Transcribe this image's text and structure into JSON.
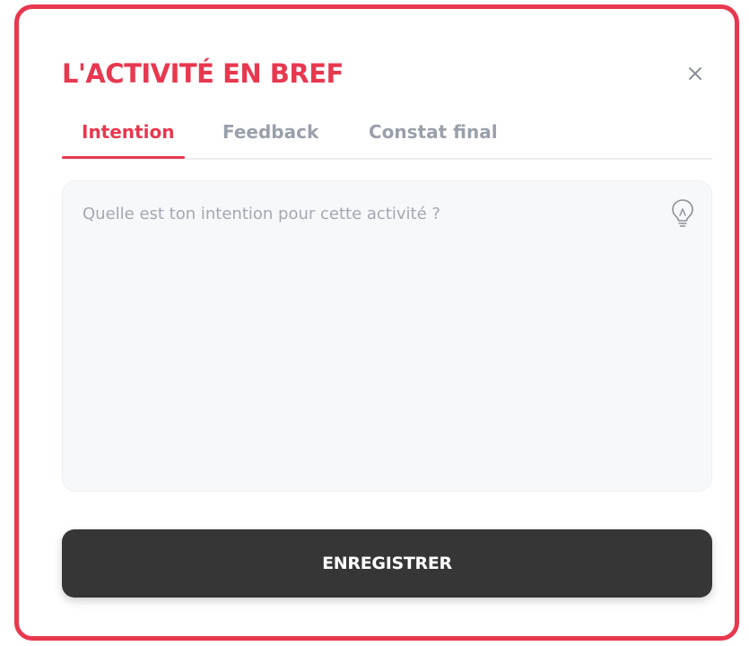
{
  "modal": {
    "title": "L'ACTIVITÉ EN BREF",
    "close_icon": "close-icon"
  },
  "tabs": [
    {
      "label": "Intention",
      "active": true
    },
    {
      "label": "Feedback",
      "active": false
    },
    {
      "label": "Constat final",
      "active": false
    }
  ],
  "intention_field": {
    "placeholder": "Quelle est ton intention pour cette activité ?",
    "value": "",
    "icon": "lightbulb-icon"
  },
  "save_button": {
    "label": "ENREGISTRER"
  },
  "colors": {
    "accent": "#e8384f",
    "tab_inactive": "#9aa0aa",
    "button_bg": "#363636",
    "field_bg": "#f7f8fa"
  }
}
